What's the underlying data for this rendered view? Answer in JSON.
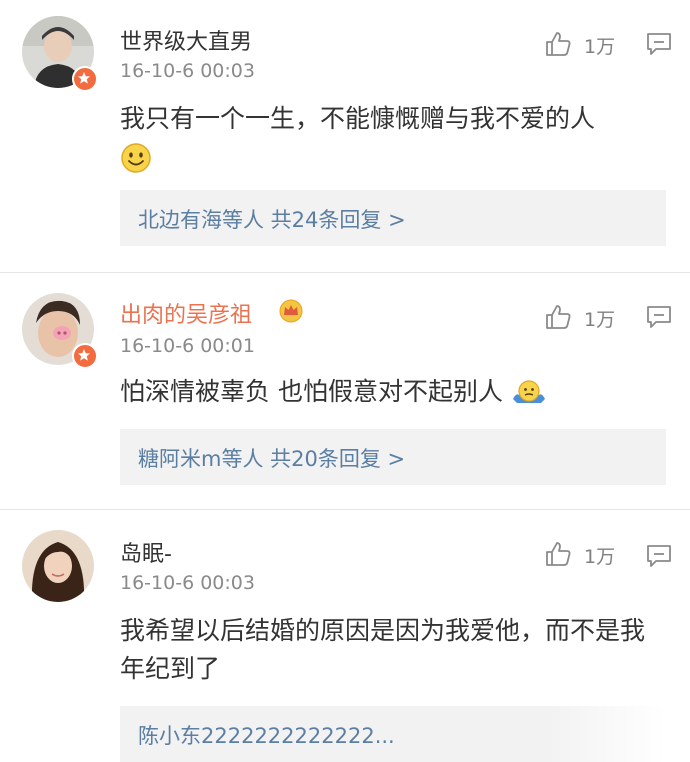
{
  "comments": [
    {
      "username": "世界级大直男",
      "time": "16-10-6 00:03",
      "likes": "1万",
      "text": "我只有一个一生，不能慷慨赠与我不爱的人",
      "emoji": "smile-emoji",
      "replies": "北边有海等人  共24条回复 >"
    },
    {
      "username": "出肉的吴彦祖",
      "time": "16-10-6 00:01",
      "likes": "1万",
      "text": "怕深情被辜负 也怕假意对不起别人",
      "emoji": "shrug-emoji",
      "replies": "糖阿米m等人  共20条回复 >"
    },
    {
      "username": "岛眠-",
      "time": "16-10-6 00:03",
      "likes": "1万",
      "text": "我希望以后结婚的原因是因为我爱他，而不是我年纪到了",
      "replies": "陈小东2222222222222..."
    }
  ],
  "colors": {
    "vip_name": "#eb7350",
    "link": "#5b7ea3",
    "badge": "#f26c3f"
  }
}
